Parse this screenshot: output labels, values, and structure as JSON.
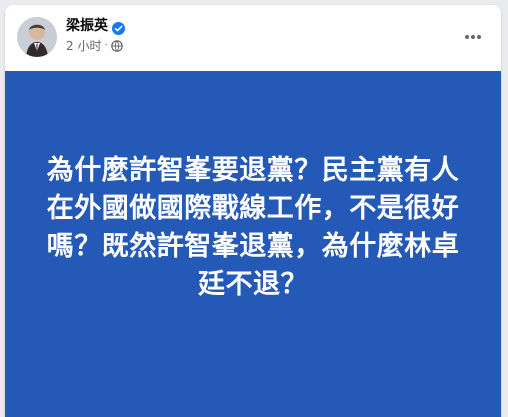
{
  "post": {
    "author_name": "梁振英",
    "timestamp": "2 小时",
    "audience_icon": "globe-icon",
    "verified_icon": "verified-badge-icon",
    "more_icon": "more-horizontal-icon",
    "background_color": "#2459b7",
    "text_color": "#ffffff",
    "text": "為什麼許智峯要退黨？民主黨有人在外國做國際戰線工作，不是很好嗎？￼既然許智峯退黨，為什麼林卓廷不退？"
  },
  "colors": {
    "verified_blue": "#1877f2",
    "secondary_text": "#65676b",
    "primary_text": "#050505"
  }
}
